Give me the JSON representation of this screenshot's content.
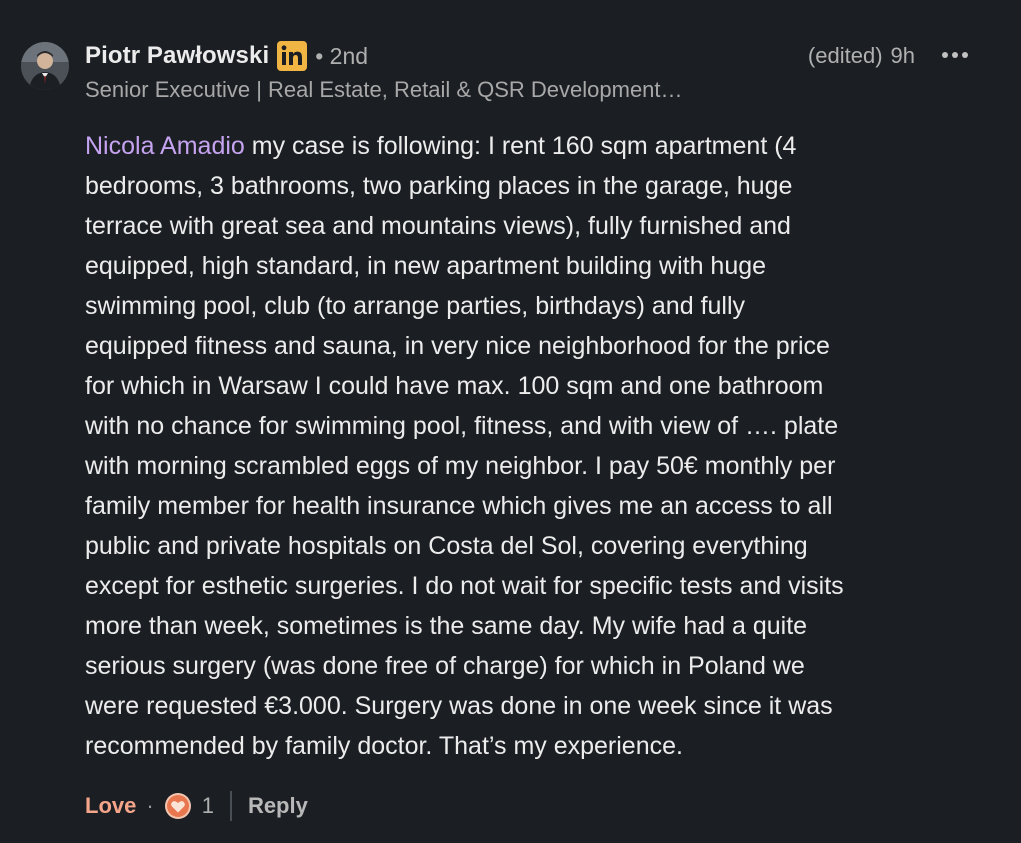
{
  "author": {
    "name": "Piotr Pawłowski",
    "degree": "• 2nd",
    "headline": "Senior Executive | Real Estate, Retail & QSR Development…",
    "badge_icon": "linkedin-icon",
    "badge_color": "#f0b542"
  },
  "meta": {
    "edited": "(edited)",
    "time": "9h",
    "more_icon": "more-horizontal-icon"
  },
  "body": {
    "mention": "Nicola Amadio",
    "first_line_rest": " my case is following: I rent 160 sqm apartment (4",
    "lines": [
      "bedrooms, 3 bathrooms, two parking places in the garage, huge",
      "terrace with great sea and mountains views), fully furnished and",
      "equipped, high standard, in new apartment building with huge",
      "swimming pool, club (to arrange parties, birthdays) and fully",
      "equipped fitness and sauna, in very nice neighborhood for the price",
      "for which in Warsaw I could have max. 100 sqm and one bathroom",
      "with no chance for swimming pool, fitness, and with view of …. plate",
      "with morning scrambled eggs of my neighbor. I pay 50€ monthly per",
      "family member for health insurance which gives me an access to all",
      "public and private hospitals on Costa del Sol, covering everything",
      "except for esthetic surgeries. I do not wait for specific tests and visits",
      "more than week, sometimes is the same day. My wife had a quite",
      "serious surgery (was done free of charge) for which in Poland we",
      "were requested €3.000. Surgery was done in one week since it was",
      "recommended by family doctor. That’s my experience."
    ]
  },
  "actions": {
    "love_label": "Love",
    "separator": "·",
    "reaction_icon": "love-reaction-icon",
    "reaction_count": "1",
    "reply_label": "Reply",
    "love_color": "#f5a58a"
  },
  "colors": {
    "background": "#1b1f23",
    "mention": "#c5a3f0",
    "text": "#ececec",
    "muted": "#b0b0b0"
  }
}
